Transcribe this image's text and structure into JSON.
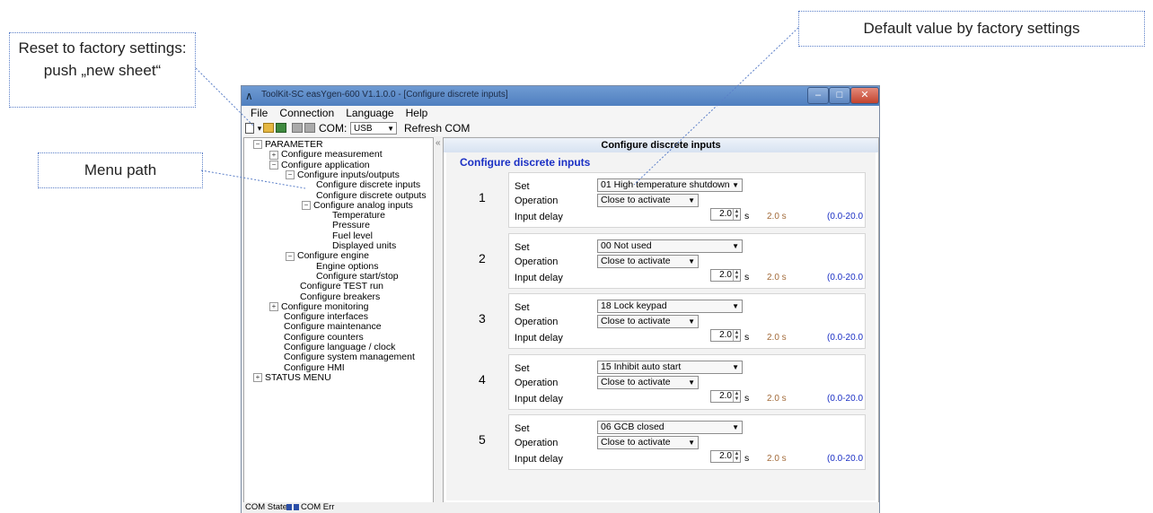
{
  "callouts": {
    "reset": "Reset to factory settings: push „new sheet“",
    "menu": "Menu path",
    "default": "Default value by factory settings"
  },
  "window": {
    "title": "ToolKit-SC easYgen-600  V1.1.0.0 - [Configure discrete inputs]",
    "menus": [
      "File",
      "Connection",
      "Language",
      "Help"
    ],
    "com_label": "COM:",
    "com_value": "USB",
    "refresh": "Refresh COM"
  },
  "tree": [
    {
      "label": "PARAMETER",
      "toggle": "−"
    },
    {
      "label": "Configure measurement",
      "toggle": "+"
    },
    {
      "label": "Configure application",
      "toggle": "−"
    },
    {
      "label": "Configure inputs/outputs",
      "toggle": "−"
    },
    {
      "label": "Configure discrete inputs",
      "toggle": ""
    },
    {
      "label": "Configure discrete outputs",
      "toggle": ""
    },
    {
      "label": "Configure analog inputs",
      "toggle": "−"
    },
    {
      "label": "Temperature",
      "toggle": ""
    },
    {
      "label": "Pressure",
      "toggle": ""
    },
    {
      "label": "Fuel level",
      "toggle": ""
    },
    {
      "label": "Displayed units",
      "toggle": ""
    },
    {
      "label": "Configure engine",
      "toggle": "−"
    },
    {
      "label": "Engine options",
      "toggle": ""
    },
    {
      "label": "Configure start/stop",
      "toggle": ""
    },
    {
      "label": "Configure TEST run",
      "toggle": ""
    },
    {
      "label": "Configure breakers",
      "toggle": ""
    },
    {
      "label": "Configure monitoring",
      "toggle": "+"
    },
    {
      "label": "Configure interfaces",
      "toggle": ""
    },
    {
      "label": "Configure maintenance",
      "toggle": ""
    },
    {
      "label": "Configure counters",
      "toggle": ""
    },
    {
      "label": "Configure language / clock",
      "toggle": ""
    },
    {
      "label": "Configure system management",
      "toggle": ""
    },
    {
      "label": "Configure HMI",
      "toggle": ""
    },
    {
      "label": "STATUS MENU",
      "toggle": "+"
    }
  ],
  "panel": {
    "header": "Configure discrete inputs",
    "heading": "Configure discrete inputs",
    "labels": {
      "set": "Set",
      "operation": "Operation",
      "delay": "Input delay"
    },
    "inputs": [
      {
        "num": "1",
        "set": "01 High temperature shutdown",
        "operation": "Close to activate",
        "delay": "2.0",
        "unit": "s",
        "default": "2.0 s",
        "range": "(0.0-20.0"
      },
      {
        "num": "2",
        "set": "00 Not used",
        "operation": "Close to activate",
        "delay": "2.0",
        "unit": "s",
        "default": "2.0 s",
        "range": "(0.0-20.0"
      },
      {
        "num": "3",
        "set": "18 Lock keypad",
        "operation": "Close to activate",
        "delay": "2.0",
        "unit": "s",
        "default": "2.0 s",
        "range": "(0.0-20.0"
      },
      {
        "num": "4",
        "set": "15 Inhibit auto start",
        "operation": "Close to activate",
        "delay": "2.0",
        "unit": "s",
        "default": "2.0 s",
        "range": "(0.0-20.0"
      },
      {
        "num": "5",
        "set": "06 GCB closed",
        "operation": "Close to activate",
        "delay": "2.0",
        "unit": "s",
        "default": "2.0 s",
        "range": "(0.0-20.0"
      }
    ]
  },
  "status": {
    "com_state": "COM State",
    "com_err": "COM Err"
  },
  "colors": {
    "heading": "#1a2fc4",
    "default_value": "#a36b3a",
    "range": "#1a2fc4",
    "titlebar": "#5b88c7"
  }
}
